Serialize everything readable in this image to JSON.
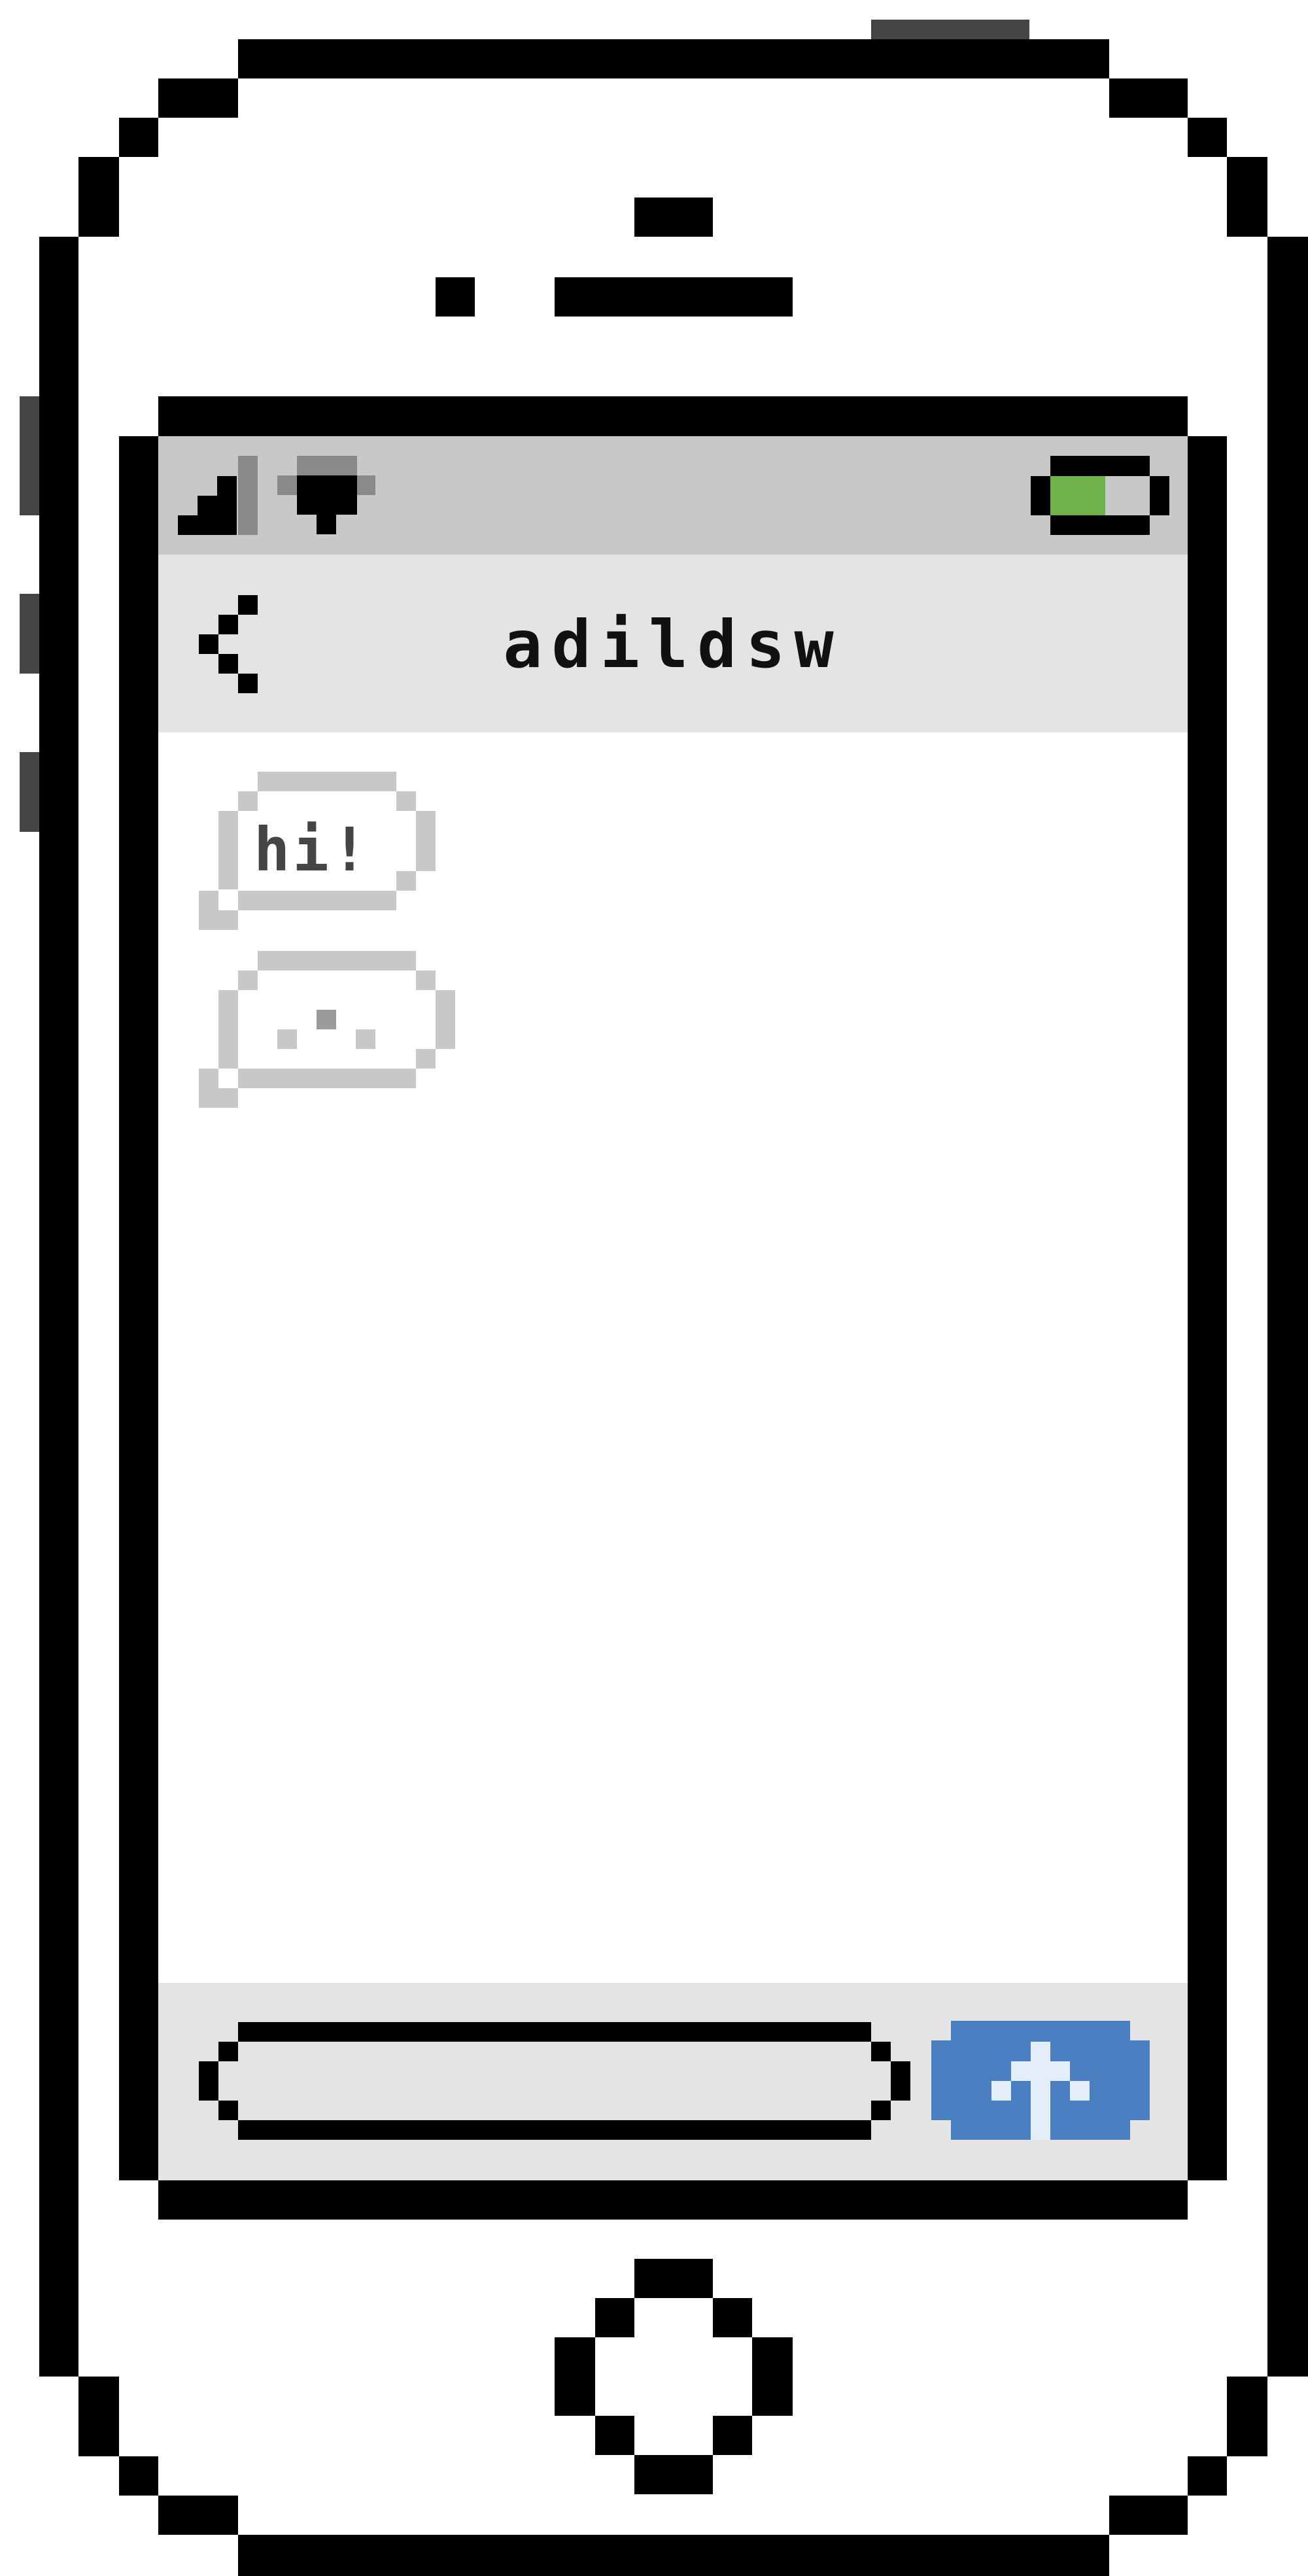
{
  "chat": {
    "title": "adildsw",
    "messages": [
      {
        "text": "hi!",
        "direction": "incoming"
      }
    ],
    "typing_indicator": true
  },
  "input": {
    "value": "",
    "placeholder": ""
  },
  "status": {
    "battery_level": 0.55,
    "signal_icon": "signal-icon",
    "wifi_icon": "wifi-icon",
    "battery_icon": "battery-icon"
  },
  "colors": {
    "accent": "#4a7fc1",
    "battery": "#6db34a",
    "status_bar": "#c8c8c8",
    "nav_bar": "#e4e4e4"
  }
}
